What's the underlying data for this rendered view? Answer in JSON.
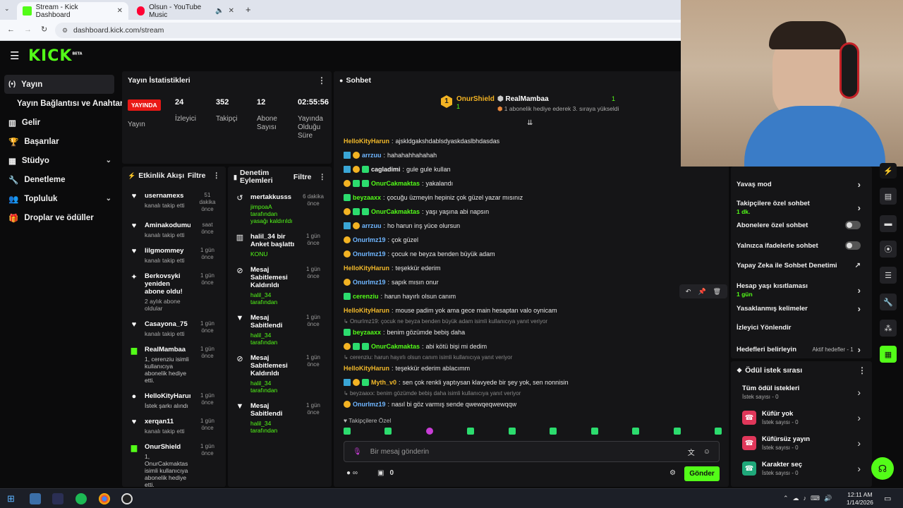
{
  "browser": {
    "tabs": [
      {
        "title": "Stream - Kick Dashboard",
        "active": true
      },
      {
        "title": "Olsun - YouTube Music",
        "active": false
      }
    ],
    "url": "dashboard.kick.com/stream"
  },
  "brand": {
    "logo": "KICK",
    "tag": "BETA",
    "accent": "#53fc18"
  },
  "sidebar": {
    "items": [
      {
        "label": "Yayın",
        "icon": "broadcast-icon",
        "active": true
      },
      {
        "label": "Yayın Bağlantısı ve Anahtarı",
        "icon": ""
      },
      {
        "label": "Gelir",
        "icon": "chart-icon"
      },
      {
        "label": "Başarılar",
        "icon": "trophy-icon"
      },
      {
        "label": "Stüdyo",
        "icon": "grid-icon",
        "chevron": true
      },
      {
        "label": "Denetleme",
        "icon": "wrench-icon"
      },
      {
        "label": "Topluluk",
        "icon": "users-icon",
        "chevron": true
      },
      {
        "label": "Droplar ve ödüller",
        "icon": "gift-icon"
      }
    ]
  },
  "stats": {
    "title": "Yayın İstatistikleri",
    "live_badge": "YAYINDA",
    "live_label": "Yayın",
    "items": [
      {
        "value": "24",
        "label": "İzleyici"
      },
      {
        "value": "352",
        "label": "Takipçi"
      },
      {
        "value": "12",
        "label": "Abone Sayısı"
      },
      {
        "value": "02:55:56",
        "label": "Yayında Olduğu Süre"
      }
    ]
  },
  "activity": {
    "title": "Etkinlik Akışı",
    "filter": "Filtre",
    "items": [
      {
        "name": "usernamexs",
        "sub": "kanalı takip etti",
        "time": "51 dakika önce",
        "icon": "heart-icon"
      },
      {
        "name": "Aminakodumun_pici",
        "sub": "kanalı takip etti",
        "time": "saat önce",
        "icon": "heart-icon"
      },
      {
        "name": "lilgmommey",
        "sub": "kanalı takip etti",
        "time": "1 gün önce",
        "icon": "heart-icon"
      },
      {
        "name": "Berkovsyki yeniden abone oldu!",
        "sub": "2 aylık abone oldular",
        "time": "1 gün önce",
        "icon": "sparkle-icon"
      },
      {
        "name": "Casayona_75",
        "sub": "kanalı takip etti",
        "time": "1 gün önce",
        "icon": "heart-icon"
      },
      {
        "name": "RealMambaa",
        "sub": "1, cerenziu isimli kullanıcıya abonelik hediye etti.",
        "time": "1 gün önce",
        "icon": "gift-icon"
      },
      {
        "name": "HelloKityHarun",
        "sub": "İstek şarkı alındı",
        "time": "1 gün önce",
        "icon": "coins-icon"
      },
      {
        "name": "xerqan11",
        "sub": "kanalı takip etti",
        "time": "1 gün önce",
        "icon": "heart-icon"
      },
      {
        "name": "OnurShield",
        "sub": "1, OnurCakmaktas isimli kullanıcıya abonelik hediye etti.",
        "time": "1 gün önce",
        "icon": "gift-icon"
      }
    ]
  },
  "modlog": {
    "title": "Denetim Eylemleri",
    "filter": "Filtre",
    "items": [
      {
        "name": "mertakkusss",
        "sub": "jimpoaA tarafından yasağı kaldırıldı",
        "time": "6 dakika önce",
        "icon": "undo-icon"
      },
      {
        "name": "halil_34 bir Anket başlattı",
        "sub": "KONU",
        "time": "1 gün önce",
        "icon": "poll-icon"
      },
      {
        "name": "Mesaj Sabitlemesi Kaldırıldı",
        "sub": "halil_34 tarafından",
        "time": "1 gün önce",
        "icon": "unpin-icon"
      },
      {
        "name": "Mesaj Sabitlendi",
        "sub": "halil_34 tarafından",
        "time": "1 gün önce",
        "icon": "pin-icon"
      },
      {
        "name": "Mesaj Sabitlemesi Kaldırıldı",
        "sub": "halil_34 tarafından",
        "time": "1 gün önce",
        "icon": "unpin-icon"
      },
      {
        "name": "Mesaj Sabitlendi",
        "sub": "halil_34 tarafından",
        "time": "1 gün önce",
        "icon": "pin-icon"
      }
    ]
  },
  "chat": {
    "title": "Sohbet",
    "top_gifters": [
      {
        "name": "OnurShield",
        "count": "1",
        "rank": "1"
      },
      {
        "name": "RealMambaa",
        "count": "1",
        "note": "1 abonelik hediye ederek 3. sıraya yükseldi"
      }
    ],
    "messages": [
      {
        "user": "HelloKityHarun",
        "color": "#f2b92a",
        "text": "ajskldgakshdablsdyaskdaslbhdasdas",
        "badges": []
      },
      {
        "user": "arrzuu",
        "color": "#6fb6ff",
        "text": "hahahahhahahah",
        "badges": [
          "blue",
          "gold"
        ]
      },
      {
        "user": "cagladimi",
        "color": "#f0f0f0",
        "text": "gule gule kullan",
        "badges": [
          "blue",
          "gold",
          "grn"
        ]
      },
      {
        "user": "OnurCakmaktas",
        "color": "#53fc18",
        "text": "yakalandı",
        "badges": [
          "gold",
          "grn",
          "grn"
        ]
      },
      {
        "user": "beyzaaxx",
        "color": "#53fc18",
        "text": "çocuğu üzmeyin hepiniz çok güzel yazar mısınız",
        "badges": [
          "grn"
        ]
      },
      {
        "user": "OnurCakmaktas",
        "color": "#53fc18",
        "text": "yaşı yaşına abi napsın",
        "badges": [
          "gold",
          "grn",
          "grn"
        ]
      },
      {
        "user": "arrzuu",
        "color": "#6fb6ff",
        "text": "ho harun inş yüce olursun",
        "badges": [
          "blue",
          "gold"
        ]
      },
      {
        "user": "OnurImz19",
        "color": "#6fb6ff",
        "text": "çok güzel",
        "badges": [
          "gold"
        ]
      },
      {
        "user": "OnurImz19",
        "color": "#6fb6ff",
        "text": "çocuk ne beyza benden büyük adam",
        "badges": [
          "gold"
        ]
      },
      {
        "user": "HelloKityHarun",
        "color": "#f2b92a",
        "text": "teşekkür ederim",
        "badges": []
      },
      {
        "user": "OnurImz19",
        "color": "#6fb6ff",
        "text": "sapık mısın onur",
        "badges": [
          "gold"
        ]
      },
      {
        "user": "cerenziu",
        "color": "#53fc18",
        "text": "harun hayırlı olsun canım",
        "badges": [
          "grn"
        ]
      },
      {
        "user": "HelloKityHarun",
        "color": "#f2b92a",
        "text": "mouse padim yok ama gece main hesaptan valo oynicam",
        "badges": []
      },
      {
        "reply": "OnurImz19: çocuk ne beyza benden büyük adam isimli kullanıcıya yanıt veriyor"
      },
      {
        "user": "beyzaaxx",
        "color": "#53fc18",
        "text": "benim gözümde bebiş daha",
        "badges": [
          "grn"
        ]
      },
      {
        "user": "OnurCakmaktas",
        "color": "#53fc18",
        "text": "abi kötü bişi mi dedim",
        "badges": [
          "gold",
          "grn",
          "grn"
        ]
      },
      {
        "reply": "cerenziu: harun hayırlı olsun canım isimli kullanıcıya yanıt veriyor"
      },
      {
        "user": "HelloKityHarun",
        "color": "#f2b92a",
        "text": "teşekkür ederim ablacımm",
        "badges": []
      },
      {
        "user": "Myth_v0",
        "color": "#f2b92a",
        "text": "sen çok renkli yaptıysan klavyede bir şey yok, sen nonnisin",
        "badges": [
          "blue",
          "gold",
          "grn"
        ]
      },
      {
        "reply": "beyzaaxx: benim gözümde bebiş daha isimli kullanıcıya yanıt veriyor"
      },
      {
        "user": "OnurImz19",
        "color": "#6fb6ff",
        "text": "nasıl bi göz varmış sende qwewqeqwewqqw",
        "badges": [
          "gold"
        ]
      }
    ],
    "followers_only": "Takipçilere Özel",
    "input_placeholder": "Bir mesaj gönderin",
    "send": "Gönder",
    "points": "0"
  },
  "settings": {
    "rows": [
      {
        "label": "Yavaş mod",
        "type": "arrow"
      },
      {
        "label": "Takipçilere özel sohbet",
        "sub": "1 dk.",
        "type": "arrow"
      },
      {
        "label": "Abonelere özel sohbet",
        "type": "toggle"
      },
      {
        "label": "Yalnızca ifadelerle sohbet",
        "type": "toggle"
      },
      {
        "label": "Yapay Zeka ile Sohbet Denetimi",
        "type": "external"
      },
      {
        "label": "Hesap yaşı kısıtlaması",
        "sub": "1 gün",
        "type": "arrow"
      },
      {
        "label": "Yasaklanmış kelimeler",
        "type": "arrow"
      },
      {
        "label": "İzleyici Yönlendir",
        "type": "none"
      },
      {
        "label": "Hedefleri belirleyin",
        "extra": "Aktif hedefler - 1",
        "type": "arrow"
      }
    ]
  },
  "rewards": {
    "title": "Ödül istek sırası",
    "items": [
      {
        "label": "Tüm ödül istekleri",
        "sub": "İstek sayısı - 0"
      },
      {
        "label": "Küfür yok",
        "sub": "İstek sayısı - 0",
        "color": "#e0375a"
      },
      {
        "label": "Küfürsüz yayın",
        "sub": "İstek sayısı - 0",
        "color": "#e0375a"
      },
      {
        "label": "Karakter seç",
        "sub": "İstek sayısı - 0",
        "color": "#1fa87a"
      }
    ]
  },
  "taskbar": {
    "time": "12:11 AM",
    "date": "1/14/2026"
  }
}
